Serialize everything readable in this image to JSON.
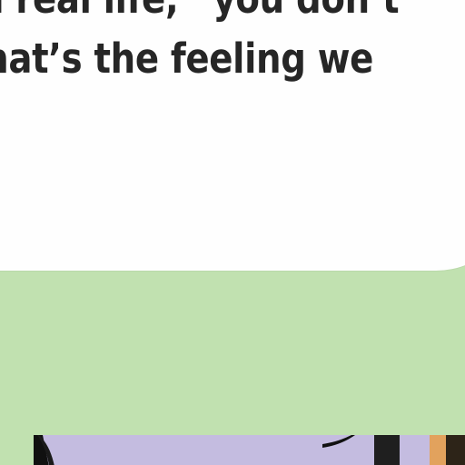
{
  "quote": {
    "line_1": "in real life,” you don’t",
    "line_2": "that’s the feeling we"
  },
  "colors": {
    "page_background": "#c1e1b0",
    "card_background": "#fefefe",
    "text": "#262626",
    "photo_sky": "#c6bedf"
  }
}
